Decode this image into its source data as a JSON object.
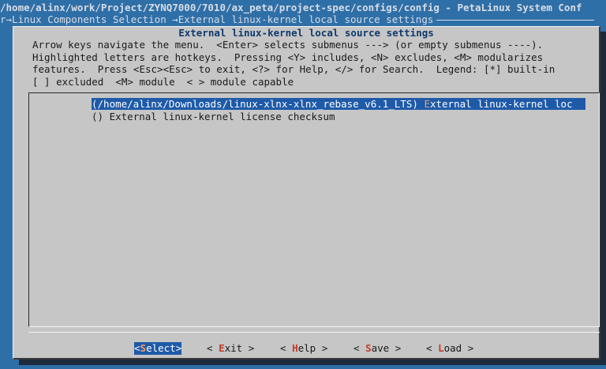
{
  "terminal": {
    "title_path": "/home/alinx/work/Project/ZYNQ7000/7010/ax_peta/project-spec/configs/config - PetaLinux System Conf",
    "breadcrumb": "r→Linux Components Selection →External linux-kernel local source settings"
  },
  "dialog": {
    "title": "External linux-kernel local source settings",
    "help_lines": [
      "Arrow keys navigate the menu.  <Enter> selects submenus ---> (or empty submenus ----).",
      "Highlighted letters are hotkeys.  Pressing <Y> includes, <N> excludes, <M> modularizes",
      "features.  Press <Esc><Esc> to exit, <?> for Help, </> for Search.  Legend: [*] built-in",
      "[ ] excluded  <M> module  < > module capable"
    ]
  },
  "menu": {
    "items": [
      {
        "value": "(/home/alinx/Downloads/linux-xlnx-xlnx_rebase_v6.1_LTS)",
        "hotkey": "E",
        "label_rest": "xternal linux-kernel loc",
        "selected": true
      },
      {
        "value": "()",
        "hotkey": "",
        "label_rest": "External linux-kernel license checksum",
        "selected": false
      }
    ]
  },
  "buttons": {
    "select": {
      "pre": "<",
      "hot": "S",
      "post": "elect>"
    },
    "exit": {
      "pre": "< ",
      "hot": "E",
      "post": "xit >"
    },
    "help": {
      "pre": "< ",
      "hot": "H",
      "post": "elp >"
    },
    "save": {
      "pre": "< ",
      "hot": "S",
      "post": "ave >"
    },
    "load": {
      "pre": "< ",
      "hot": "L",
      "post": "oad >"
    }
  },
  "colors": {
    "background": "#2f6fa7",
    "dialog": "#c6c6c6",
    "selection": "#1e5aa8",
    "hotkey": "#c23a2a",
    "title": "#0e3a6c"
  }
}
